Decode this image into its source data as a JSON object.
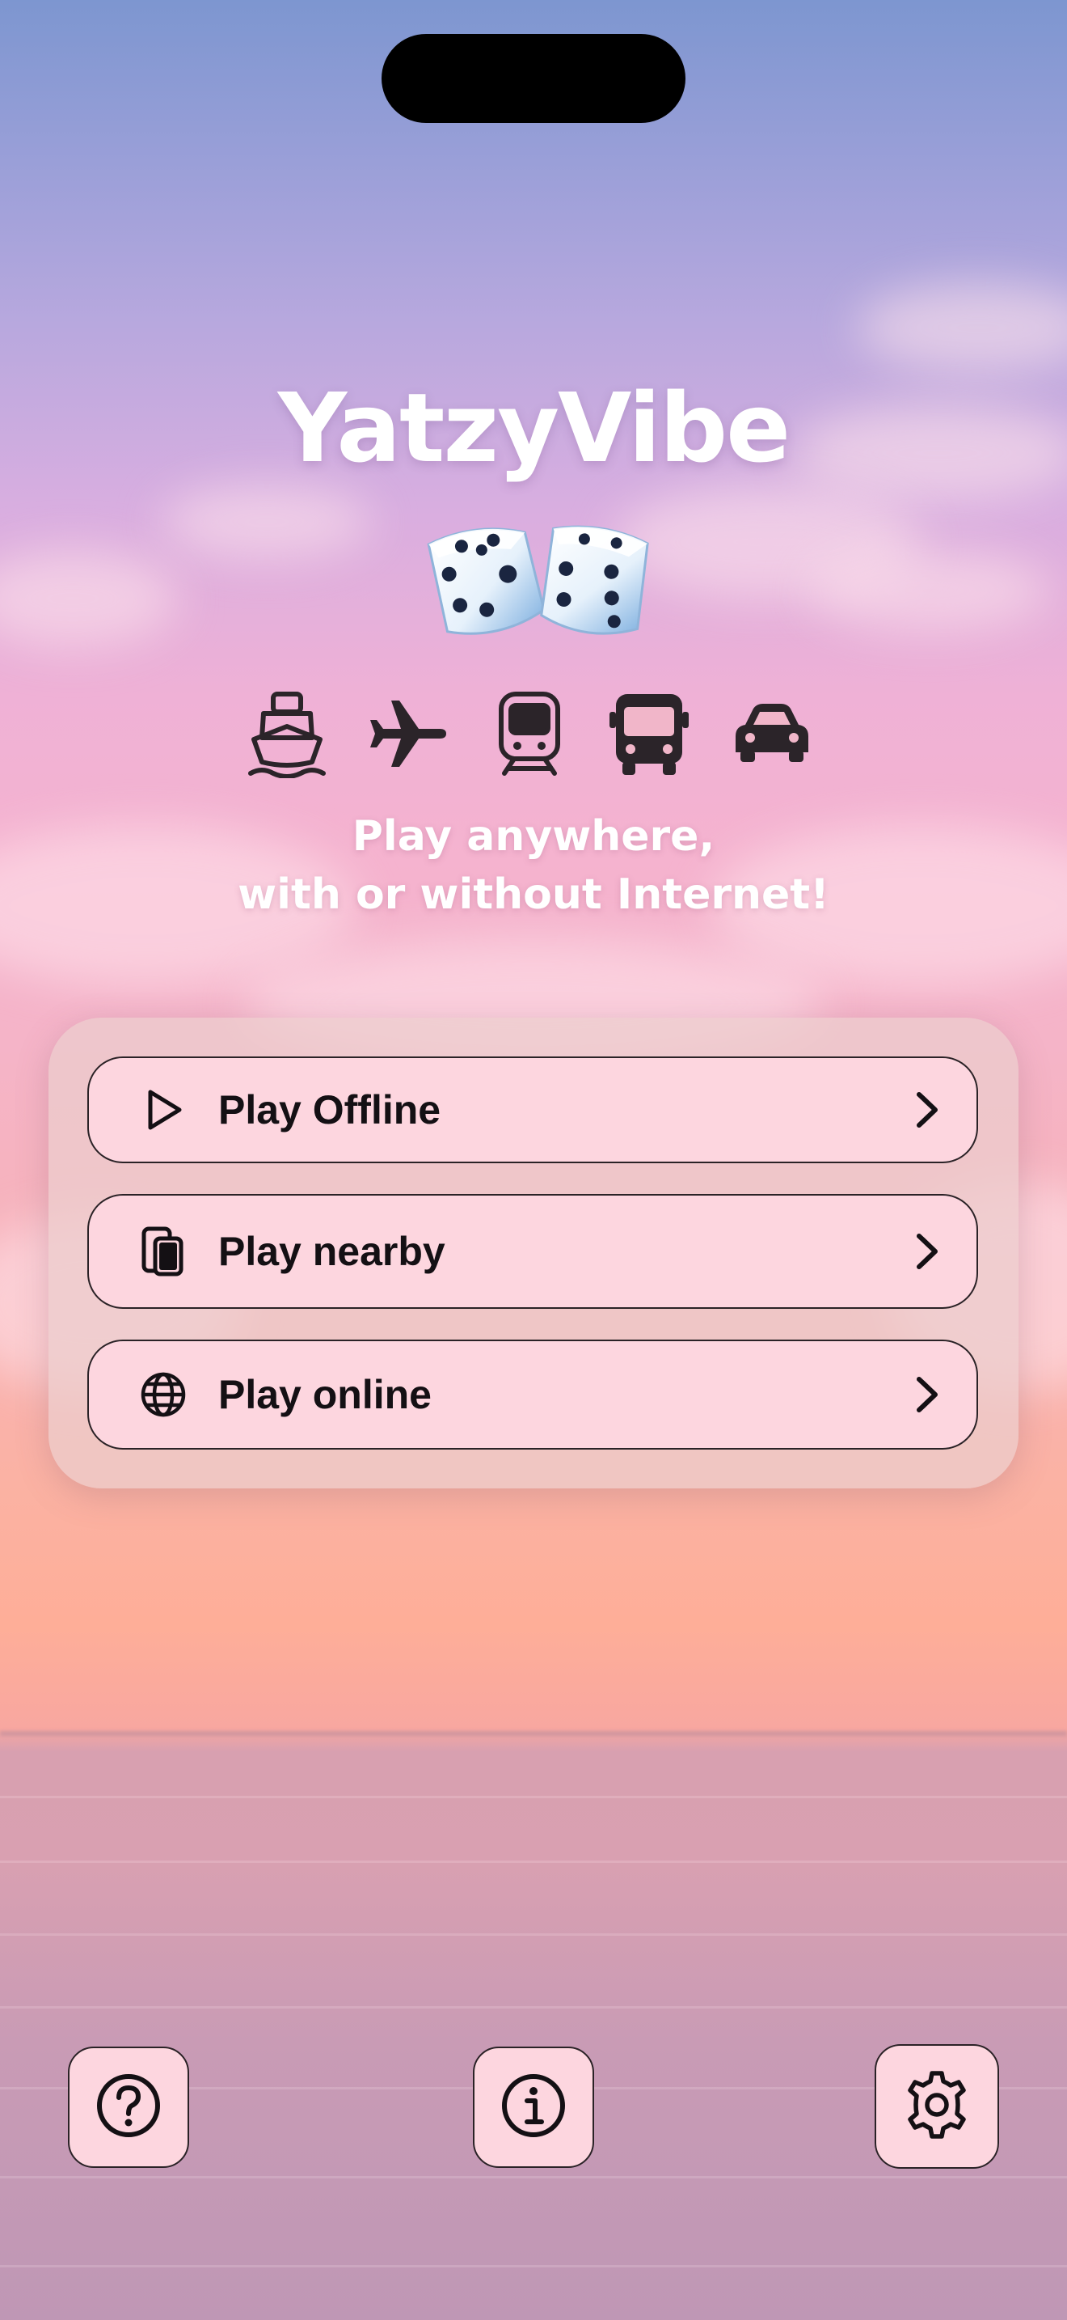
{
  "app": {
    "title": "YatzyVibe",
    "tagline_line1": "Play anywhere,",
    "tagline_line2": "with or without Internet!"
  },
  "hero": {
    "dice_icon": "two-dice",
    "transport_icons": [
      "ship-icon",
      "airplane-icon",
      "train-icon",
      "bus-icon",
      "car-icon"
    ]
  },
  "menu": {
    "items": [
      {
        "label": "Play Offline",
        "icon": "play-icon"
      },
      {
        "label": "Play nearby",
        "icon": "devices-icon"
      },
      {
        "label": "Play online",
        "icon": "globe-icon"
      }
    ]
  },
  "toolbar": {
    "help_icon": "question-icon",
    "info_icon": "info-icon",
    "settings_icon": "gear-icon"
  },
  "colors": {
    "button_fill": "#fdd6df",
    "button_border": "#2a2226",
    "text_dark": "#141014",
    "title_white": "#ffffff"
  }
}
